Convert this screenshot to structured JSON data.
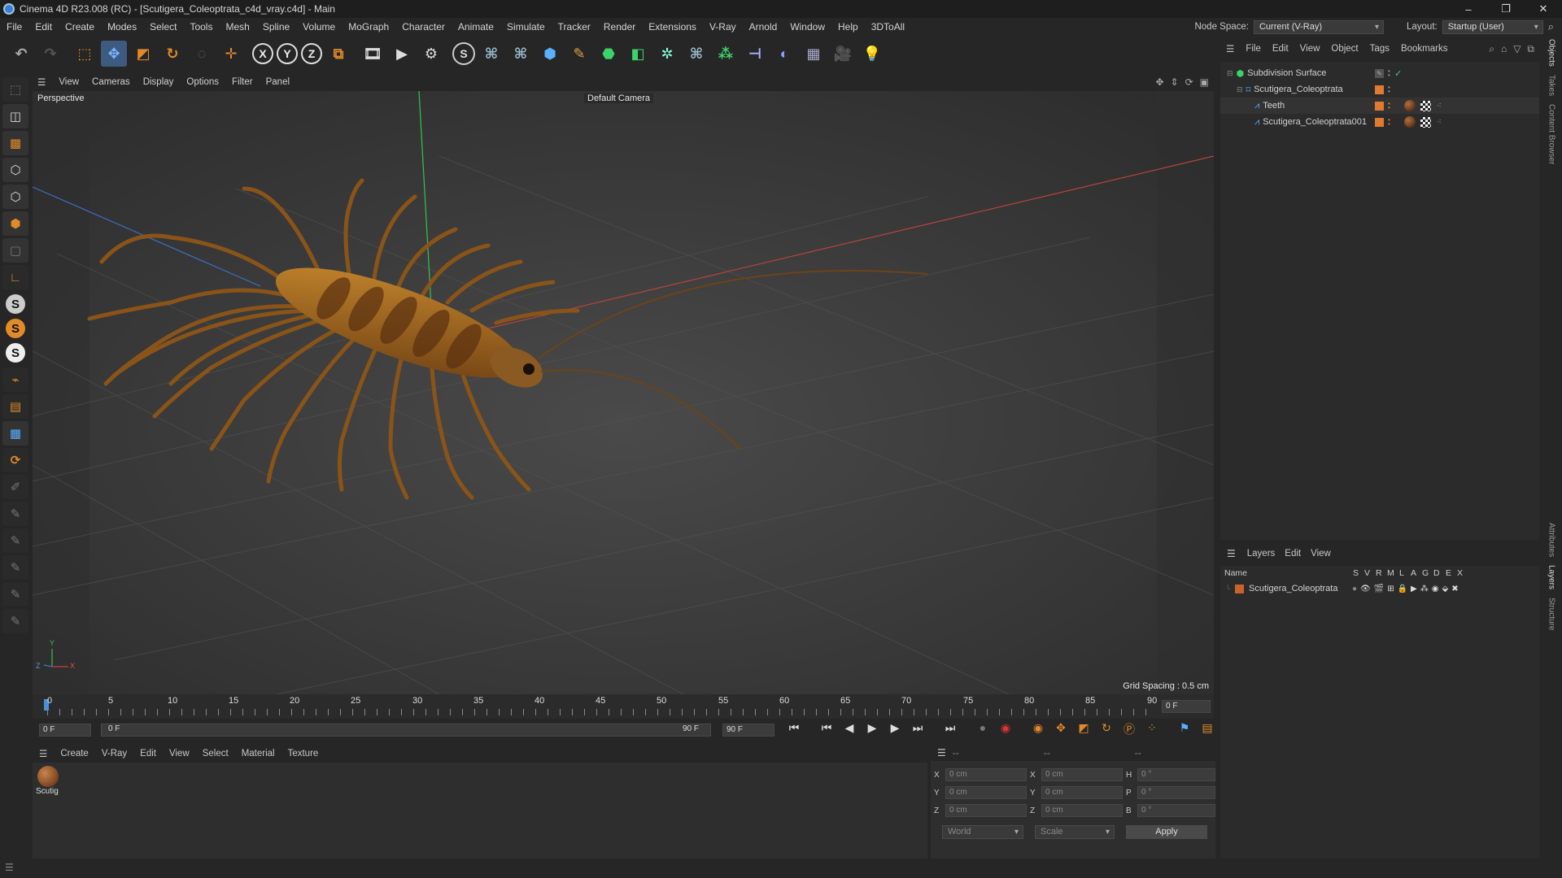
{
  "window": {
    "title": "Cinema 4D R23.008 (RC) - [Scutigera_Coleoptrata_c4d_vray.c4d] - Main",
    "buttons": [
      "–",
      "❐",
      "✕"
    ]
  },
  "menubar": {
    "items": [
      "File",
      "Edit",
      "Create",
      "Modes",
      "Select",
      "Tools",
      "Mesh",
      "Spline",
      "Volume",
      "MoGraph",
      "Character",
      "Animate",
      "Simulate",
      "Tracker",
      "Render",
      "Extensions",
      "V-Ray",
      "Arnold",
      "Window",
      "Help",
      "3DToAll"
    ],
    "node_space_label": "Node Space:",
    "node_space_value": "Current (V-Ray)",
    "layout_label": "Layout:",
    "layout_value": "Startup (User)"
  },
  "viewport": {
    "menu": [
      "View",
      "Cameras",
      "Display",
      "Options",
      "Filter",
      "Panel"
    ],
    "label": "Perspective",
    "camera": "Default Camera",
    "grid_spacing": "Grid Spacing : 0.5 cm",
    "axis_labels": {
      "y": "Y",
      "z": "Z",
      "x": "X"
    }
  },
  "timeline": {
    "ticks": [
      "0",
      "5",
      "10",
      "15",
      "20",
      "25",
      "30",
      "35",
      "40",
      "45",
      "50",
      "55",
      "60",
      "65",
      "70",
      "75",
      "80",
      "85",
      "90"
    ],
    "frame_end_field": "0 F"
  },
  "transport": {
    "current_frame": "0 F",
    "range_start": "0 F",
    "range_end": "90 F",
    "end_frame": "90 F"
  },
  "material_manager": {
    "menu": [
      "Create",
      "V-Ray",
      "Edit",
      "View",
      "Select",
      "Material",
      "Texture"
    ],
    "materials": [
      {
        "name": "Scutig"
      }
    ]
  },
  "coordinates": {
    "header_left": "--",
    "header_mid": "--",
    "header_right": "--",
    "rows": [
      {
        "a": "X",
        "av": "0 cm",
        "b": "X",
        "bv": "0 cm",
        "c": "H",
        "cv": "0 °"
      },
      {
        "a": "Y",
        "av": "0 cm",
        "b": "Y",
        "bv": "0 cm",
        "c": "P",
        "cv": "0 °"
      },
      {
        "a": "Z",
        "av": "0 cm",
        "b": "Z",
        "bv": "0 cm",
        "c": "B",
        "cv": "0 °"
      }
    ],
    "mode": "World",
    "scale": "Scale",
    "apply": "Apply"
  },
  "object_manager": {
    "menu": [
      "File",
      "Edit",
      "View",
      "Object",
      "Tags",
      "Bookmarks"
    ],
    "objects": [
      {
        "name": "Subdivision Surface",
        "depth": 0
      },
      {
        "name": "Scutigera_Coleoptrata",
        "depth": 1
      },
      {
        "name": "Teeth",
        "depth": 2
      },
      {
        "name": "Scutigera_Coleoptrata001",
        "depth": 2
      }
    ]
  },
  "layer_manager": {
    "menu": [
      "Layers",
      "Edit",
      "View"
    ],
    "columns": [
      "Name",
      "S",
      "V",
      "R",
      "M",
      "L",
      "A",
      "G",
      "D",
      "E",
      "X"
    ],
    "layers": [
      {
        "name": "Scutigera_Coleoptrata",
        "color": "#c8642a"
      }
    ]
  },
  "side_tabs": [
    "Objects",
    "Takes",
    "Content Browser",
    "Attributes",
    "Layers",
    "Structure"
  ],
  "colors": {
    "accent_blue": "#4a90d9",
    "layer_orange": "#c8642a",
    "record_red": "#d33"
  }
}
